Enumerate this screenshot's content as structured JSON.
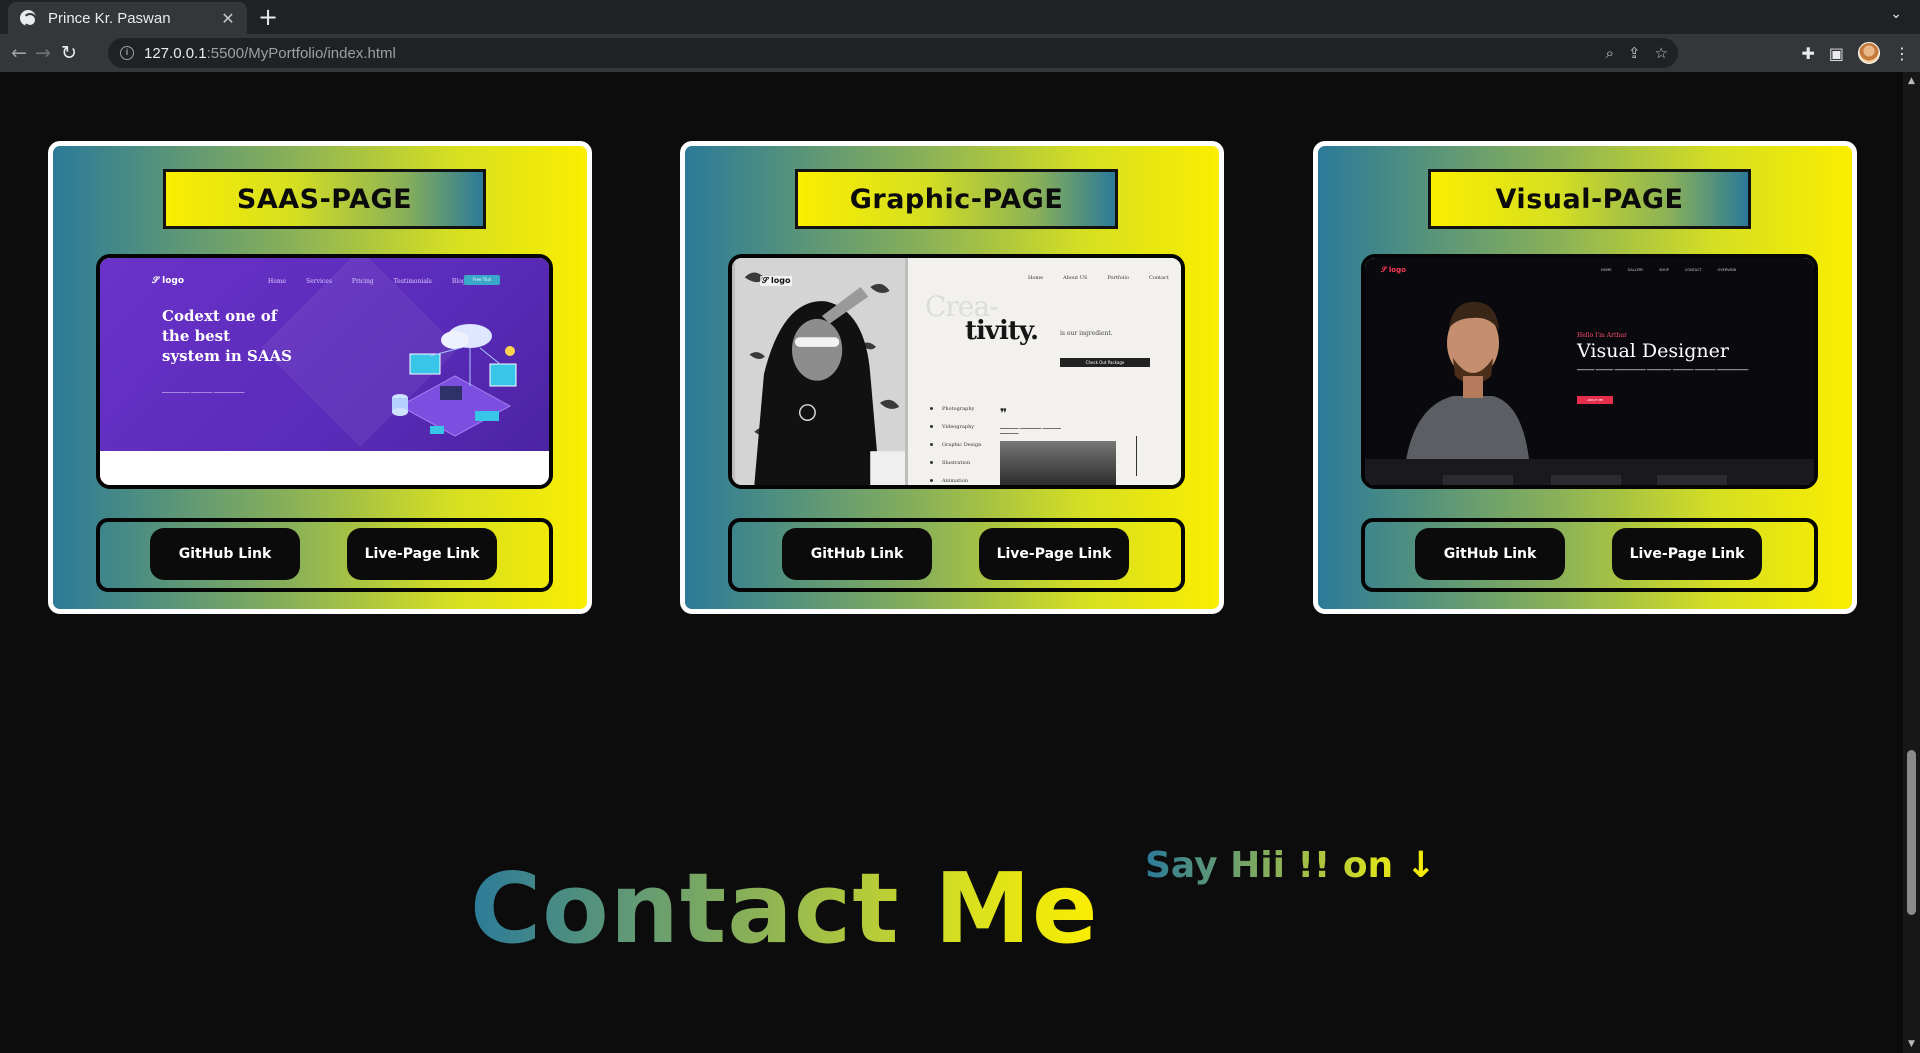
{
  "browser": {
    "tab_title": "Prince Kr. Paswan",
    "url_host": "127.0.0.1",
    "url_rest": ":5500/MyPortfolio/index.html"
  },
  "projects": [
    {
      "title": "SAAS-PAGE",
      "github_label": "GitHub Link",
      "live_label": "Live-Page Link",
      "preview": {
        "logo": "logo",
        "nav": [
          "Home",
          "Services",
          "Pricing",
          "Testimonials",
          "Blog"
        ],
        "nav_button": "Free Trial",
        "headline": "Codext one of the best system in SAAS"
      }
    },
    {
      "title": "Graphic-PAGE",
      "github_label": "GitHub Link",
      "live_label": "Live-Page Link",
      "preview": {
        "logo": "logo",
        "nav": [
          "Home",
          "About US",
          "Portfolio",
          "Contact"
        ],
        "word_top": "Crea-",
        "word_bottom": "tivity.",
        "tagline": "is our ingredient.",
        "button": "Check Out Package",
        "menu": [
          "Photography",
          "Videography",
          "Graphic Design",
          "Illustration",
          "Animation"
        ]
      }
    },
    {
      "title": "Visual-PAGE",
      "github_label": "GitHub Link",
      "live_label": "Live-Page Link",
      "preview": {
        "logo": "logo",
        "nav": [
          "HOME",
          "GALLERY",
          "SHOP",
          "CONTACT",
          "OVERVIEW"
        ],
        "greeting": "Hello I'm Arthur",
        "heading": "Visual Designer",
        "button": "ABOUT ME"
      }
    }
  ],
  "contact": {
    "title": "Contact Me",
    "say_hii": "Say Hii !! on ↓"
  },
  "colors": {
    "gradient_start": "#2b7a99",
    "gradient_mid": "#8ab158",
    "gradient_end": "#fbee00",
    "page_bg": "#0c0c0c"
  }
}
